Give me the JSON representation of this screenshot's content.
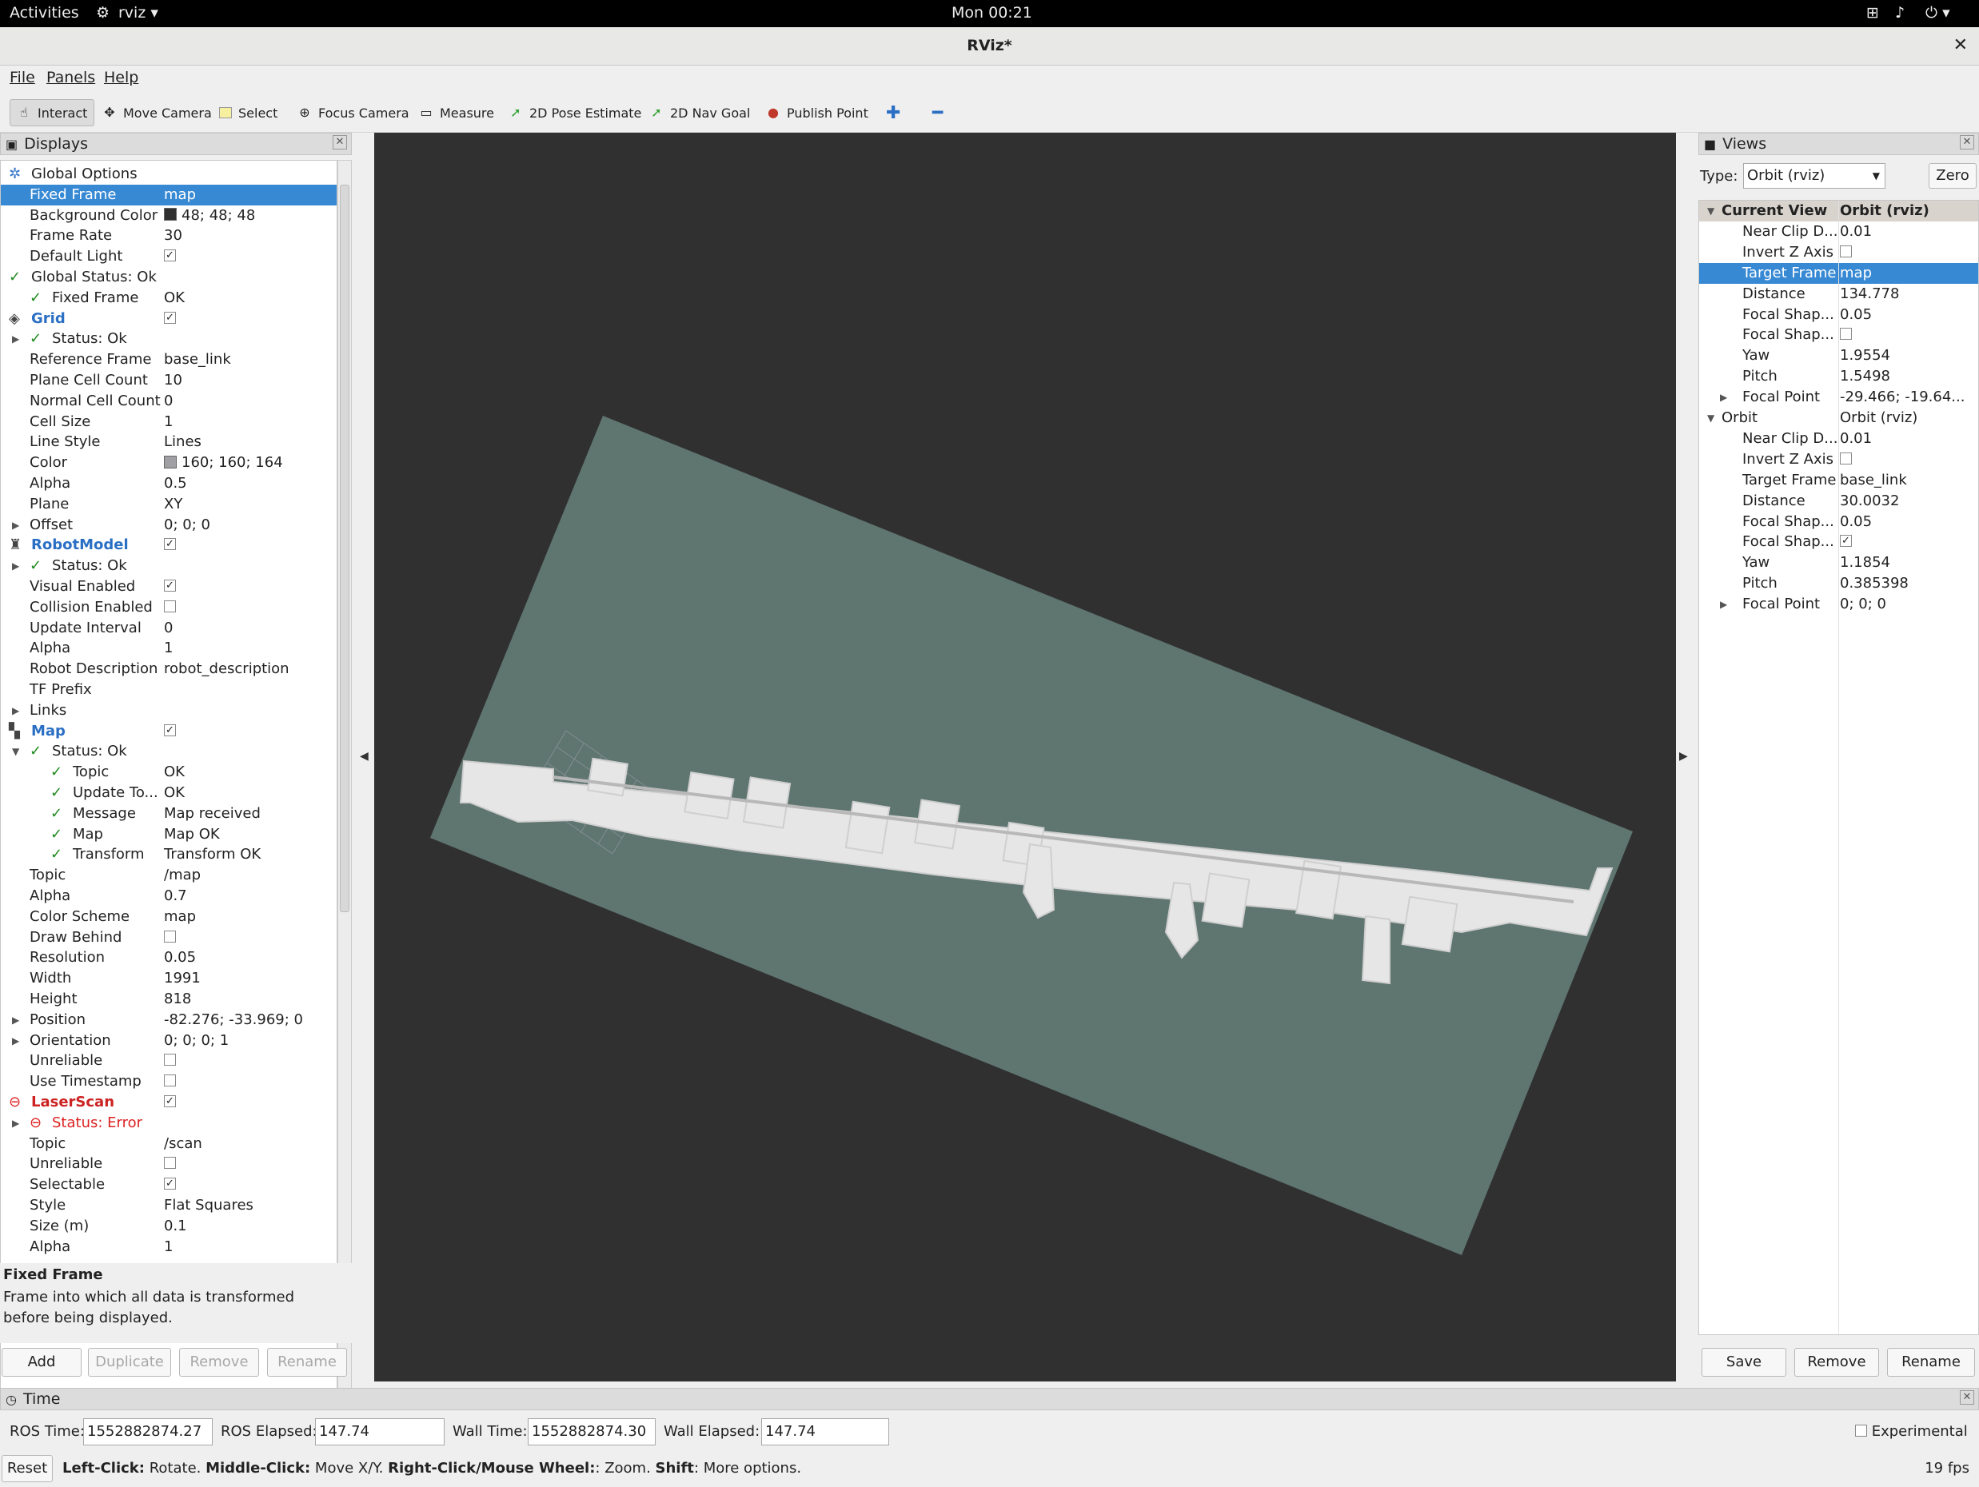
{
  "gnome": {
    "activities": "Activities",
    "app": "rviz",
    "clock": "Mon 00:21"
  },
  "window": {
    "title": "RViz*"
  },
  "menu": [
    "File",
    "Panels",
    "Help"
  ],
  "toolbar": [
    {
      "label": "Interact",
      "icon": "cursor-icon"
    },
    {
      "label": "Move Camera",
      "icon": "move-icon"
    },
    {
      "label": "Select",
      "icon": "select-box-icon"
    },
    {
      "label": "Focus Camera",
      "icon": "focus-icon"
    },
    {
      "label": "Measure",
      "icon": "ruler-icon"
    },
    {
      "label": "2D Pose Estimate",
      "icon": "green-arrow-icon"
    },
    {
      "label": "2D Nav Goal",
      "icon": "green-arrow-icon"
    },
    {
      "label": "Publish Point",
      "icon": "map-pin-icon"
    }
  ],
  "displays": {
    "title": "Displays",
    "rows": [
      {
        "k": "Global Options",
        "v": ""
      },
      {
        "k": "Fixed Frame",
        "v": "map"
      },
      {
        "k": "Background Color",
        "v": "48; 48; 48"
      },
      {
        "k": "Frame Rate",
        "v": "30"
      },
      {
        "k": "Default Light",
        "v": ""
      },
      {
        "k": "Global Status: Ok",
        "v": ""
      },
      {
        "k": "Fixed Frame",
        "v": "OK"
      },
      {
        "k": "Grid",
        "v": ""
      },
      {
        "k": "Status: Ok",
        "v": ""
      },
      {
        "k": "Reference Frame",
        "v": "base_link"
      },
      {
        "k": "Plane Cell Count",
        "v": "10"
      },
      {
        "k": "Normal Cell Count",
        "v": "0"
      },
      {
        "k": "Cell Size",
        "v": "1"
      },
      {
        "k": "Line Style",
        "v": "Lines"
      },
      {
        "k": "Color",
        "v": "160; 160; 164"
      },
      {
        "k": "Alpha",
        "v": "0.5"
      },
      {
        "k": "Plane",
        "v": "XY"
      },
      {
        "k": "Offset",
        "v": "0; 0; 0"
      },
      {
        "k": "RobotModel",
        "v": ""
      },
      {
        "k": "Status: Ok",
        "v": ""
      },
      {
        "k": "Visual Enabled",
        "v": ""
      },
      {
        "k": "Collision Enabled",
        "v": ""
      },
      {
        "k": "Update Interval",
        "v": "0"
      },
      {
        "k": "Alpha",
        "v": "1"
      },
      {
        "k": "Robot Description",
        "v": "robot_description"
      },
      {
        "k": "TF Prefix",
        "v": ""
      },
      {
        "k": "Links",
        "v": ""
      },
      {
        "k": "Map",
        "v": ""
      },
      {
        "k": "Status: Ok",
        "v": ""
      },
      {
        "k": "Topic",
        "v": "OK"
      },
      {
        "k": "Update To...",
        "v": "OK"
      },
      {
        "k": "Message",
        "v": "Map received"
      },
      {
        "k": "Map",
        "v": "Map OK"
      },
      {
        "k": "Transform",
        "v": "Transform OK"
      },
      {
        "k": "Topic",
        "v": "/map"
      },
      {
        "k": "Alpha",
        "v": "0.7"
      },
      {
        "k": "Color Scheme",
        "v": "map"
      },
      {
        "k": "Draw Behind",
        "v": ""
      },
      {
        "k": "Resolution",
        "v": "0.05"
      },
      {
        "k": "Width",
        "v": "1991"
      },
      {
        "k": "Height",
        "v": "818"
      },
      {
        "k": "Position",
        "v": "-82.276; -33.969; 0"
      },
      {
        "k": "Orientation",
        "v": "0; 0; 0; 1"
      },
      {
        "k": "Unreliable",
        "v": ""
      },
      {
        "k": "Use Timestamp",
        "v": ""
      },
      {
        "k": "LaserScan",
        "v": ""
      },
      {
        "k": "Status: Error",
        "v": ""
      },
      {
        "k": "Topic",
        "v": "/scan"
      },
      {
        "k": "Unreliable",
        "v": ""
      },
      {
        "k": "Selectable",
        "v": ""
      },
      {
        "k": "Style",
        "v": "Flat Squares"
      },
      {
        "k": "Size (m)",
        "v": "0.1"
      },
      {
        "k": "Alpha",
        "v": "1"
      }
    ],
    "help_title": "Fixed Frame",
    "help_text": "Frame into which all data is transformed before being displayed.",
    "buttons": [
      "Add",
      "Duplicate",
      "Remove",
      "Rename"
    ]
  },
  "views": {
    "title": "Views",
    "type_label": "Type:",
    "type_value": "Orbit (rviz)",
    "zero": "Zero",
    "rows": [
      {
        "k": "Current View",
        "v": "Orbit (rviz)"
      },
      {
        "k": "Near Clip D...",
        "v": "0.01"
      },
      {
        "k": "Invert Z Axis",
        "v": ""
      },
      {
        "k": "Target Frame",
        "v": "map"
      },
      {
        "k": "Distance",
        "v": "134.778"
      },
      {
        "k": "Focal Shap...",
        "v": "0.05"
      },
      {
        "k": "Focal Shap...",
        "v": ""
      },
      {
        "k": "Yaw",
        "v": "1.9554"
      },
      {
        "k": "Pitch",
        "v": "1.5498"
      },
      {
        "k": "Focal Point",
        "v": "-29.466; -19.64..."
      },
      {
        "k": "Orbit",
        "v": "Orbit (rviz)"
      },
      {
        "k": "Near Clip D...",
        "v": "0.01"
      },
      {
        "k": "Invert Z Axis",
        "v": ""
      },
      {
        "k": "Target Frame",
        "v": "base_link"
      },
      {
        "k": "Distance",
        "v": "30.0032"
      },
      {
        "k": "Focal Shap...",
        "v": "0.05"
      },
      {
        "k": "Focal Shap...",
        "v": ""
      },
      {
        "k": "Yaw",
        "v": "1.1854"
      },
      {
        "k": "Pitch",
        "v": "0.385398"
      },
      {
        "k": "Focal Point",
        "v": "0; 0; 0"
      }
    ],
    "buttons": [
      "Save",
      "Remove",
      "Rename"
    ]
  },
  "time": {
    "title": "Time",
    "ros_time_label": "ROS Time:",
    "ros_time": "1552882874.27",
    "ros_elapsed_label": "ROS Elapsed:",
    "ros_elapsed": "147.74",
    "wall_time_label": "Wall Time:",
    "wall_time": "1552882874.30",
    "wall_elapsed_label": "Wall Elapsed:",
    "wall_elapsed": "147.74",
    "experimental": "Experimental",
    "reset": "Reset",
    "hint_lc": "Left-Click:",
    "hint_lc_t": " Rotate. ",
    "hint_mc": "Middle-Click:",
    "hint_mc_t": " Move X/Y. ",
    "hint_rc": "Right-Click/Mouse Wheel:",
    "hint_rc_t": ": Zoom. ",
    "hint_sh": "Shift",
    "hint_sh_t": ": More options.",
    "fps": "19 fps"
  },
  "colors": {
    "accent": "#3889d4",
    "viewport_bg": "#303030",
    "map_plane": "#5f7570"
  }
}
